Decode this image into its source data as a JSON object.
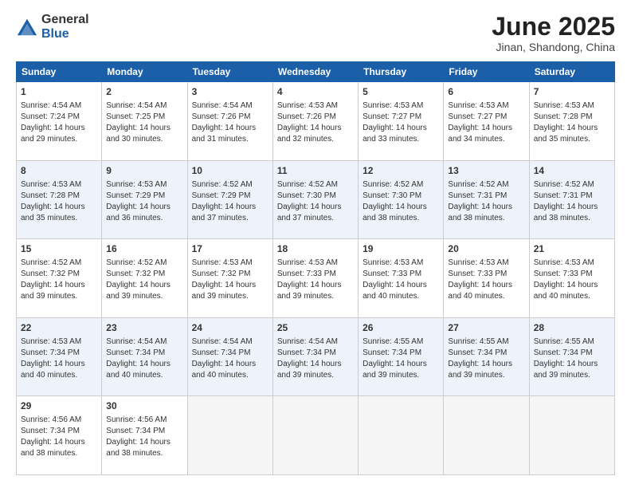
{
  "header": {
    "logo_general": "General",
    "logo_blue": "Blue",
    "month_title": "June 2025",
    "location": "Jinan, Shandong, China"
  },
  "days_of_week": [
    "Sunday",
    "Monday",
    "Tuesday",
    "Wednesday",
    "Thursday",
    "Friday",
    "Saturday"
  ],
  "weeks": [
    [
      {
        "day": 1,
        "info": "Sunrise: 4:54 AM\nSunset: 7:24 PM\nDaylight: 14 hours\nand 29 minutes."
      },
      {
        "day": 2,
        "info": "Sunrise: 4:54 AM\nSunset: 7:25 PM\nDaylight: 14 hours\nand 30 minutes."
      },
      {
        "day": 3,
        "info": "Sunrise: 4:54 AM\nSunset: 7:26 PM\nDaylight: 14 hours\nand 31 minutes."
      },
      {
        "day": 4,
        "info": "Sunrise: 4:53 AM\nSunset: 7:26 PM\nDaylight: 14 hours\nand 32 minutes."
      },
      {
        "day": 5,
        "info": "Sunrise: 4:53 AM\nSunset: 7:27 PM\nDaylight: 14 hours\nand 33 minutes."
      },
      {
        "day": 6,
        "info": "Sunrise: 4:53 AM\nSunset: 7:27 PM\nDaylight: 14 hours\nand 34 minutes."
      },
      {
        "day": 7,
        "info": "Sunrise: 4:53 AM\nSunset: 7:28 PM\nDaylight: 14 hours\nand 35 minutes."
      }
    ],
    [
      {
        "day": 8,
        "info": "Sunrise: 4:53 AM\nSunset: 7:28 PM\nDaylight: 14 hours\nand 35 minutes."
      },
      {
        "day": 9,
        "info": "Sunrise: 4:53 AM\nSunset: 7:29 PM\nDaylight: 14 hours\nand 36 minutes."
      },
      {
        "day": 10,
        "info": "Sunrise: 4:52 AM\nSunset: 7:29 PM\nDaylight: 14 hours\nand 37 minutes."
      },
      {
        "day": 11,
        "info": "Sunrise: 4:52 AM\nSunset: 7:30 PM\nDaylight: 14 hours\nand 37 minutes."
      },
      {
        "day": 12,
        "info": "Sunrise: 4:52 AM\nSunset: 7:30 PM\nDaylight: 14 hours\nand 38 minutes."
      },
      {
        "day": 13,
        "info": "Sunrise: 4:52 AM\nSunset: 7:31 PM\nDaylight: 14 hours\nand 38 minutes."
      },
      {
        "day": 14,
        "info": "Sunrise: 4:52 AM\nSunset: 7:31 PM\nDaylight: 14 hours\nand 38 minutes."
      }
    ],
    [
      {
        "day": 15,
        "info": "Sunrise: 4:52 AM\nSunset: 7:32 PM\nDaylight: 14 hours\nand 39 minutes."
      },
      {
        "day": 16,
        "info": "Sunrise: 4:52 AM\nSunset: 7:32 PM\nDaylight: 14 hours\nand 39 minutes."
      },
      {
        "day": 17,
        "info": "Sunrise: 4:53 AM\nSunset: 7:32 PM\nDaylight: 14 hours\nand 39 minutes."
      },
      {
        "day": 18,
        "info": "Sunrise: 4:53 AM\nSunset: 7:33 PM\nDaylight: 14 hours\nand 39 minutes."
      },
      {
        "day": 19,
        "info": "Sunrise: 4:53 AM\nSunset: 7:33 PM\nDaylight: 14 hours\nand 40 minutes."
      },
      {
        "day": 20,
        "info": "Sunrise: 4:53 AM\nSunset: 7:33 PM\nDaylight: 14 hours\nand 40 minutes."
      },
      {
        "day": 21,
        "info": "Sunrise: 4:53 AM\nSunset: 7:33 PM\nDaylight: 14 hours\nand 40 minutes."
      }
    ],
    [
      {
        "day": 22,
        "info": "Sunrise: 4:53 AM\nSunset: 7:34 PM\nDaylight: 14 hours\nand 40 minutes."
      },
      {
        "day": 23,
        "info": "Sunrise: 4:54 AM\nSunset: 7:34 PM\nDaylight: 14 hours\nand 40 minutes."
      },
      {
        "day": 24,
        "info": "Sunrise: 4:54 AM\nSunset: 7:34 PM\nDaylight: 14 hours\nand 40 minutes."
      },
      {
        "day": 25,
        "info": "Sunrise: 4:54 AM\nSunset: 7:34 PM\nDaylight: 14 hours\nand 39 minutes."
      },
      {
        "day": 26,
        "info": "Sunrise: 4:55 AM\nSunset: 7:34 PM\nDaylight: 14 hours\nand 39 minutes."
      },
      {
        "day": 27,
        "info": "Sunrise: 4:55 AM\nSunset: 7:34 PM\nDaylight: 14 hours\nand 39 minutes."
      },
      {
        "day": 28,
        "info": "Sunrise: 4:55 AM\nSunset: 7:34 PM\nDaylight: 14 hours\nand 39 minutes."
      }
    ],
    [
      {
        "day": 29,
        "info": "Sunrise: 4:56 AM\nSunset: 7:34 PM\nDaylight: 14 hours\nand 38 minutes."
      },
      {
        "day": 30,
        "info": "Sunrise: 4:56 AM\nSunset: 7:34 PM\nDaylight: 14 hours\nand 38 minutes."
      },
      {
        "day": null,
        "info": ""
      },
      {
        "day": null,
        "info": ""
      },
      {
        "day": null,
        "info": ""
      },
      {
        "day": null,
        "info": ""
      },
      {
        "day": null,
        "info": ""
      }
    ]
  ]
}
